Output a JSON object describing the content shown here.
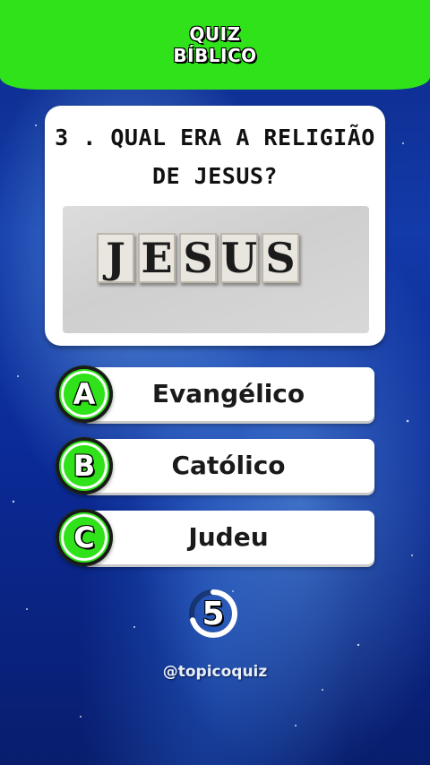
{
  "header": {
    "line1": "QUIZ",
    "line2": "BÍBLICO",
    "color": "#2fe21a"
  },
  "question": {
    "line1": "3 . QUAL ERA A RELIGIÃO",
    "line2": "DE JESUS?"
  },
  "image": {
    "letters": [
      "J",
      "E",
      "S",
      "U",
      "S"
    ]
  },
  "options": [
    {
      "letter": "A",
      "text": "Evangélico"
    },
    {
      "letter": "B",
      "text": "Católico"
    },
    {
      "letter": "C",
      "text": "Judeu"
    }
  ],
  "timer": {
    "value": "5",
    "remaining_fraction": 0.7
  },
  "handle": "@topicoquiz",
  "icons": [
    "timer-icon"
  ]
}
